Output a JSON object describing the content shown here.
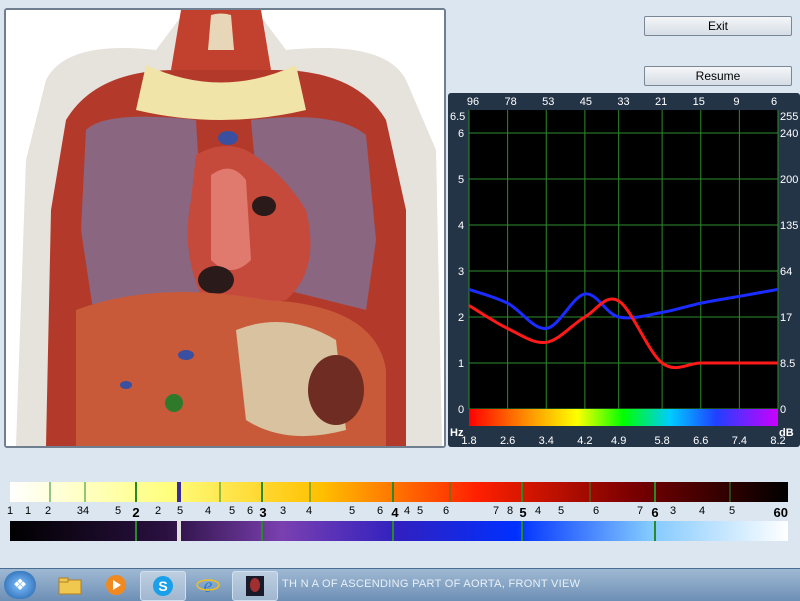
{
  "buttons": {
    "exit_label": "Exit",
    "resume_label": "Resume"
  },
  "graph": {
    "top_axis_labels": [
      "96",
      "78",
      "53",
      "45",
      "33",
      "21",
      "15",
      "9",
      "6"
    ],
    "left_axis_labels": [
      "6.5",
      "6",
      "5",
      "4",
      "3",
      "2",
      "1",
      "0"
    ],
    "right_axis_labels": [
      "255",
      "240",
      "200",
      "135",
      "64",
      "17",
      "8.5",
      "0"
    ],
    "bottom_axis_labels": [
      "1.8",
      "2.6",
      "3.4",
      "4.2",
      "4.9",
      "5.8",
      "6.6",
      "7.4",
      "8.2"
    ],
    "highlighted_bottom_index": 5,
    "hz_label": "Hz",
    "db_label": "dB",
    "colors": {
      "background": "#000000",
      "grid": "#2e8b2e",
      "blue_series": "#1a2cff",
      "red_series": "#ff1a1a",
      "highlight_tick": "#33a0ff"
    }
  },
  "chart_data": {
    "type": "line",
    "x": [
      1.8,
      2.6,
      3.4,
      4.2,
      4.9,
      5.8,
      6.6,
      7.4,
      8.2
    ],
    "series": [
      {
        "values": [
          2.6,
          2.3,
          1.75,
          2.5,
          2.0,
          2.1,
          2.3,
          2.45,
          2.6
        ]
      },
      {
        "values": [
          2.25,
          1.75,
          1.45,
          2.0,
          2.35,
          1.0,
          1.0,
          1.0,
          1.0
        ]
      }
    ],
    "ylim": [
      0,
      6.5
    ],
    "xlim": [
      1.8,
      8.2
    ],
    "grid": true
  },
  "scale": {
    "labels": [
      {
        "text": "1"
      },
      {
        "text": "1"
      },
      {
        "text": "2"
      },
      {
        "text": "34"
      },
      {
        "text": "5"
      },
      {
        "text": "2",
        "big": true
      },
      {
        "text": "2"
      },
      {
        "text": "5"
      },
      {
        "text": "4"
      },
      {
        "text": "5"
      },
      {
        "text": "6"
      },
      {
        "text": "3",
        "big": true
      },
      {
        "text": "3"
      },
      {
        "text": "4"
      },
      {
        "text": "5"
      },
      {
        "text": "6"
      },
      {
        "text": "4",
        "big": true
      },
      {
        "text": "4"
      },
      {
        "text": "5"
      },
      {
        "text": "6"
      },
      {
        "text": "7"
      },
      {
        "text": "8"
      },
      {
        "text": "5",
        "big": true
      },
      {
        "text": "4"
      },
      {
        "text": "5"
      },
      {
        "text": "6"
      },
      {
        "text": "7"
      },
      {
        "text": "6",
        "big": true
      },
      {
        "text": "3"
      },
      {
        "text": "4"
      },
      {
        "text": "5"
      },
      {
        "text": "60",
        "big": true
      }
    ]
  },
  "taskbar": {
    "window_title": "TH  N  A  OF ASCENDING PART OF AORTA, FRONT VIEW"
  }
}
